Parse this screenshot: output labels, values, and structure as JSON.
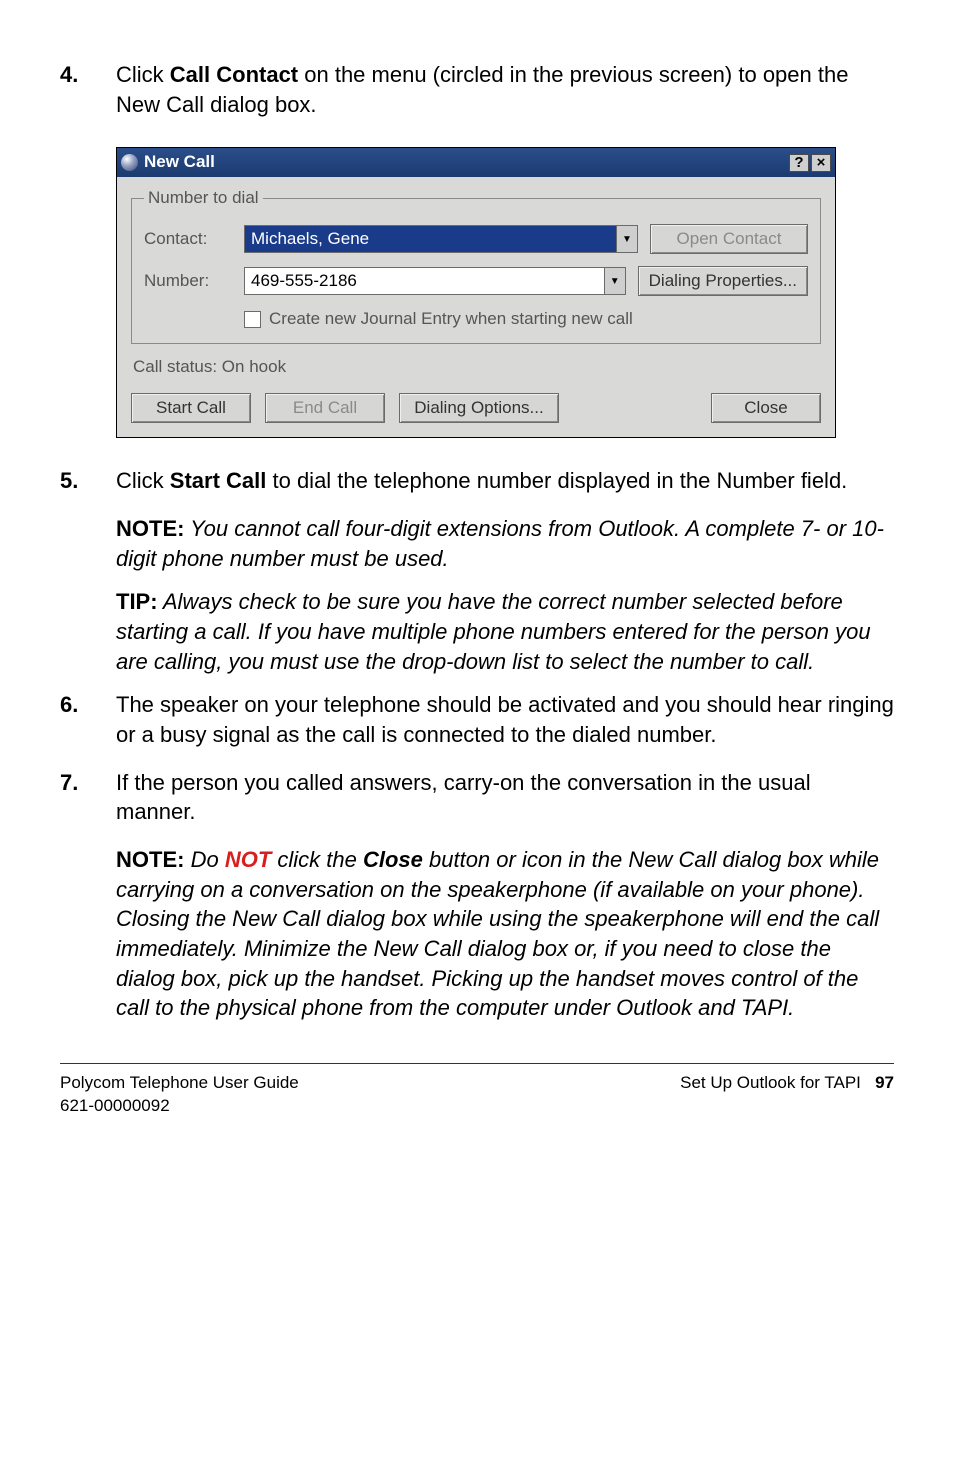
{
  "step4": {
    "num": "4.",
    "text_pre": "Click ",
    "bold": "Call Contact",
    "text_post": " on the menu (circled in the previous screen) to open the New Call dialog box."
  },
  "dialog": {
    "title": "New Call",
    "help_btn": "?",
    "close_btn": "×",
    "group_legend": "Number to dial",
    "contact_label": "Contact:",
    "contact_value": "Michaels, Gene",
    "open_contact_btn": "Open Contact",
    "number_label": "Number:",
    "number_value": "469-555-2186",
    "dial_props_btn": "Dialing Properties...",
    "journal_checkbox": "Create new Journal Entry when starting new call",
    "status": "Call status: On hook",
    "start_call_btn": "Start Call",
    "end_call_btn": "End Call",
    "dial_options_btn": "Dialing Options...",
    "close_btn_label": "Close"
  },
  "step5": {
    "num": "5.",
    "text_pre": "Click ",
    "bold": "Start Call",
    "text_post": " to dial the telephone number displayed in the Number field."
  },
  "note5": {
    "label": "NOTE:",
    "text": " You cannot call four-digit extensions from Outlook.   A complete 7- or 10-digit phone number must be used."
  },
  "tip5": {
    "label": "TIP:",
    "text": " Always check to be sure you have the correct number selected before starting a call. If you have multiple phone numbers entered for the person you are calling, you must use the drop-down list to select the number to call."
  },
  "step6": {
    "num": "6.",
    "text": "The speaker on your telephone should be activated and you should hear ringing or a busy signal as the call is connected to the dialed number."
  },
  "step7": {
    "num": "7.",
    "text": "If the person you called answers, carry-on the conversation in the usual manner."
  },
  "note7": {
    "label": "NOTE:",
    "pre": " Do ",
    "not": "NOT",
    "mid": " click the ",
    "close_word": "Close",
    "post": " button or icon in the New Call dialog box while carrying on a conversation on the speakerphone (if available on your phone). Closing the New Call dialog box while using the speakerphone will end the call immediately. Minimize the New Call dialog box or, if you need to close the dialog box, pick up the handset. Picking up the handset moves control of the call to the physical phone from the computer under Outlook and TAPI."
  },
  "footer": {
    "left1": "Polycom Telephone User Guide",
    "left2": "621-00000092",
    "right_label": "Set Up Outlook for TAPI",
    "page": "97"
  }
}
